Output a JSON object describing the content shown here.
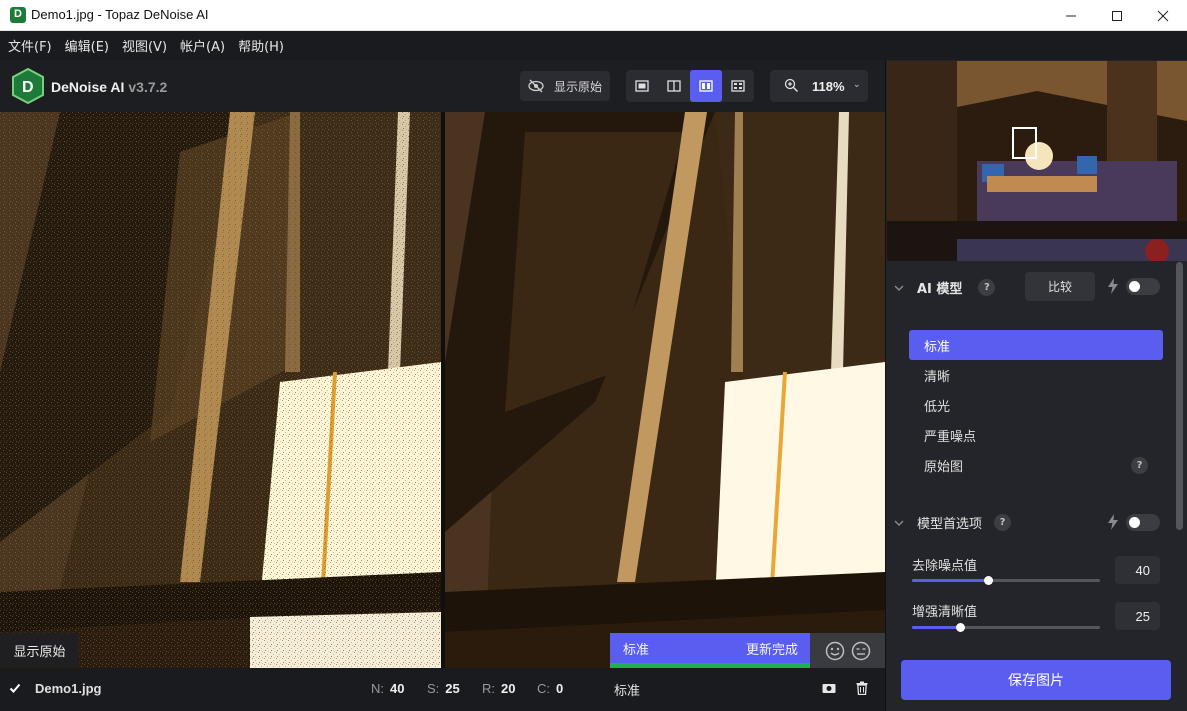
{
  "window": {
    "title": "Demo1.jpg - Topaz DeNoise AI",
    "app_icon": "topaz-denoise-app-icon"
  },
  "menu": [
    "文件(F)",
    "编辑(E)",
    "视图(V)",
    "帐户(A)",
    "帮助(H)"
  ],
  "toolbar": {
    "brand": "DeNoise AI",
    "version": "v3.7.2",
    "show_original": "显示原始",
    "view_modes": [
      "single-view",
      "split-view",
      "side-by-side-view",
      "quad-view"
    ],
    "active_view": "side-by-side-view",
    "zoom": "118%"
  },
  "preview": {
    "original_label": "显示原始",
    "processed_model": "标准",
    "processed_status": "更新完成",
    "progress": 1.0
  },
  "bottom": {
    "filename": "Demo1.jpg",
    "stats": [
      {
        "key": "N:",
        "value": "40"
      },
      {
        "key": "S:",
        "value": "25"
      },
      {
        "key": "R:",
        "value": "20"
      },
      {
        "key": "C:",
        "value": "0"
      }
    ],
    "model": "标准"
  },
  "panel": {
    "ai_model": {
      "title": "AI 模型",
      "compare": "比较",
      "models": [
        "标准",
        "清晰",
        "低光",
        "严重噪点",
        "原始图"
      ],
      "selected": "标准"
    },
    "model_prefs": {
      "title": "模型首选项",
      "sliders": [
        {
          "label": "去除噪点值",
          "value": "40",
          "fraction": 0.4
        },
        {
          "label": "增强清晰值",
          "value": "25",
          "fraction": 0.25
        }
      ]
    },
    "save": "保存图片"
  },
  "colors": {
    "accent": "#5a5ef0",
    "success": "#20b050",
    "panel_bg": "#24252a",
    "toolbar_bg": "#1d1e22"
  }
}
